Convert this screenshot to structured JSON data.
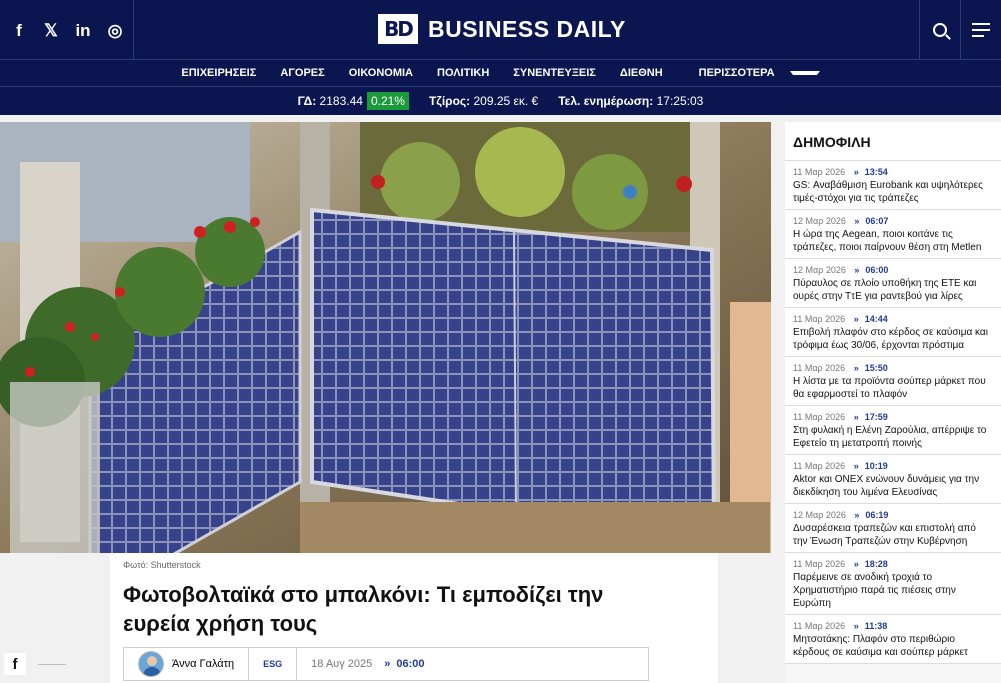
{
  "header": {
    "social": [
      {
        "name": "facebook-icon",
        "glyph": "f"
      },
      {
        "name": "x-icon",
        "glyph": "𝕏"
      },
      {
        "name": "linkedin-icon",
        "glyph": "in"
      },
      {
        "name": "instagram-icon",
        "glyph": "◎"
      }
    ],
    "logo_mark": "BD",
    "logo_text": "BUSINESS DAILY"
  },
  "nav": {
    "items": [
      "ΕΠΙΧΕΙΡΗΣΕΙΣ",
      "ΑΓΟΡΕΣ",
      "ΟΙΚΟΝΟΜΙΑ",
      "ΠΟΛΙΤΙΚΗ",
      "ΣΥΝΕΝΤΕΥΞΕΙΣ",
      "ΔΙΕΘΝΗ",
      "ΠΕΡΙΣΣΟΤΕΡΑ"
    ]
  },
  "ticker": {
    "gd_label": "ΓΔ:",
    "gd_value": "2183.44",
    "gd_change": "0.21%",
    "turnover_label": "Τζίρος:",
    "turnover_value": "209.25 εκ. €",
    "update_label": "Τελ. ενημέρωση:",
    "update_value": "17:25:03",
    "positive_color": "#1a9a3a"
  },
  "article": {
    "photo_credit": "Φωτό: Shutterstock",
    "headline": "Φωτοβολταϊκά στο μπαλκόνι: Τι εμποδίζει την ευρεία χρήση τους",
    "author": "Άννα Γαλάτη",
    "category": "ESG",
    "date": "18 Αυγ 2025",
    "time": "06:00"
  },
  "sidebar": {
    "title": "ΔΗΜΟΦΙΛΗ",
    "items": [
      {
        "date": "11 Μαρ 2026",
        "time": "13:54",
        "title": "GS: Αναβάθμιση Eurobank και υψηλότερες τιμές-στόχοι για τις τράπεζες"
      },
      {
        "date": "12 Μαρ 2026",
        "time": "06:07",
        "title": "Η ώρα της Aegean, ποιοι κοιτάνε τις τράπεζες, ποιοι παίρνουν θέση στη Metlen"
      },
      {
        "date": "12 Μαρ 2026",
        "time": "06:00",
        "title": "Πύραυλος σε πλοίο υποθήκη της ΕΤΕ και ουρές στην ΤτΕ για ραντεβού για λίρες"
      },
      {
        "date": "11 Μαρ 2026",
        "time": "14:44",
        "title": "Επιβολή πλαφόν στο κέρδος σε καύσιμα και τρόφιμα έως 30/06, έρχονται πρόστιμα"
      },
      {
        "date": "11 Μαρ 2026",
        "time": "15:50",
        "title": "Η λίστα με τα προϊόντα σούπερ μάρκετ που θα εφαρμοστεί το πλαφόν"
      },
      {
        "date": "11 Μαρ 2026",
        "time": "17:59",
        "title": "Στη φυλακή η Ελένη Ζαρούλια, απέρριψε το Εφετείο τη μετατροπή ποινής"
      },
      {
        "date": "11 Μαρ 2026",
        "time": "10:19",
        "title": "Aktor και ΟΝΕΧ ενώνουν δυνάμεις για την διεκδίκηση του λιμένα Ελευσίνας"
      },
      {
        "date": "12 Μαρ 2026",
        "time": "06:19",
        "title": "Δυσαρέσκεια τραπεζών και επιστολή από την Ένωση Τραπεζών στην Κυβέρνηση"
      },
      {
        "date": "11 Μαρ 2026",
        "time": "18:28",
        "title": "Παρέμεινε σε ανοδική τροχιά το Χρηματιστήριο παρά τις πιέσεις στην Ευρώπη"
      },
      {
        "date": "11 Μαρ 2026",
        "time": "11:38",
        "title": "Μητσοτάκης: Πλαφόν στο περιθώριο κέρδους σε καύσιμα και σούπερ μάρκετ"
      }
    ]
  }
}
